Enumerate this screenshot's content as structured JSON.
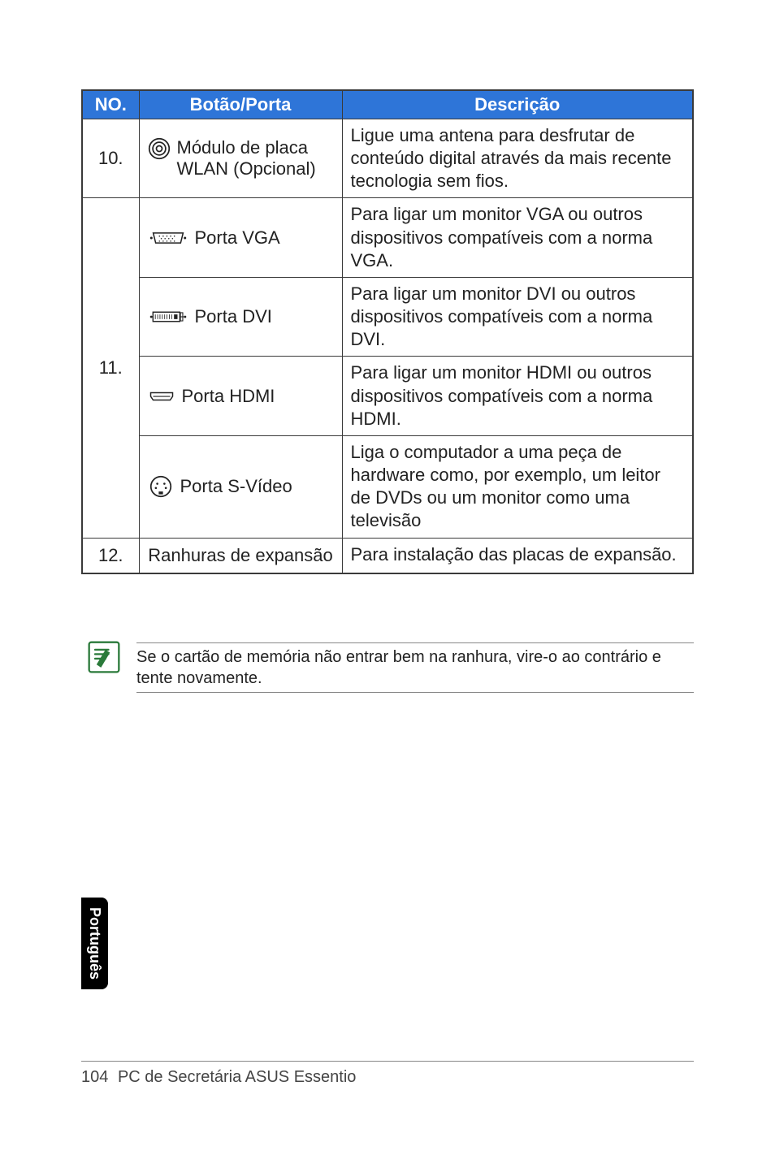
{
  "table": {
    "headers": {
      "no": "NO.",
      "bp": "Botão/Porta",
      "desc": "Descrição"
    },
    "rows": [
      {
        "no": "10.",
        "bp_label": "Módulo de placa WLAN (Opcional)",
        "icon": "antenna-icon",
        "desc": "Ligue uma antena para desfrutar de conteúdo digital através da mais recente tecnologia sem fios."
      }
    ],
    "row11": {
      "no": "11.",
      "ports": [
        {
          "icon": "vga-icon",
          "label": "Porta VGA",
          "desc": "Para ligar um monitor VGA ou outros dispositivos compatíveis com a norma VGA."
        },
        {
          "icon": "dvi-icon",
          "label": "Porta DVI",
          "desc": "Para ligar um monitor DVI ou outros dispositivos compatíveis com a norma DVI."
        },
        {
          "icon": "hdmi-icon",
          "label": "Porta HDMI",
          "desc": "Para ligar um monitor HDMI ou outros dispositivos compatíveis com a norma HDMI."
        },
        {
          "icon": "svideo-icon",
          "label": "Porta S-Vídeo",
          "desc": "Liga o computador a uma peça de hardware como, por exemplo, um leitor de DVDs ou um monitor como uma televisão"
        }
      ]
    },
    "row12": {
      "no": "12.",
      "bp_label": "Ranhuras de expansão",
      "desc": "Para instalação das placas de expansão."
    }
  },
  "note": "Se o cartão de memória não entrar bem na ranhura, vire-o ao contrário e tente novamente.",
  "side_tab": "Português",
  "footer": {
    "page_number": "104",
    "title": "PC de Secretária ASUS Essentio"
  }
}
